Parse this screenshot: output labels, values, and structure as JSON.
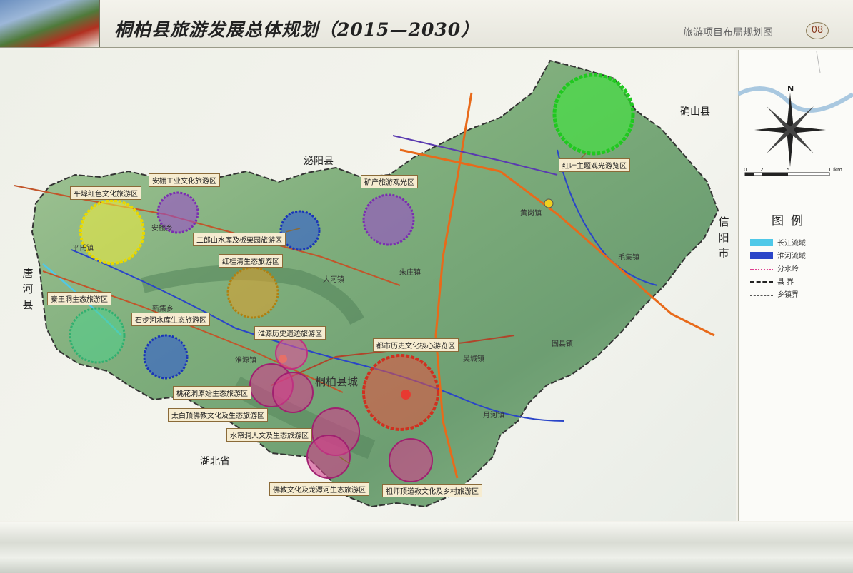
{
  "header": {
    "title": "桐柏县旅游发展总体规划（2015—2030）",
    "subtitle": "旅游项目布局规划图",
    "page_number": "08"
  },
  "surrounding_regions": {
    "biyang": "泌阳县",
    "queshan": "确山县",
    "xinyang": "信阳市",
    "tanghe": "唐河县",
    "hubei": "湖北省"
  },
  "towns": {
    "county_seat": "桐柏县城",
    "dahe": "大河镇",
    "zhuzhuang": "朱庄镇",
    "huanggang": "黄岗镇",
    "maoji": "毛集镇",
    "guxian": "固县镇",
    "wucheng": "吴城镇",
    "yuehe": "月河镇",
    "xinji": "新集乡",
    "huaiyuan": "淮源镇",
    "pingshi": "平氏镇",
    "anpeng": "安棚乡"
  },
  "zones": [
    {
      "label": "平埠红色文化旅游区",
      "color": "#f2ee3a"
    },
    {
      "label": "安棚工业文化旅游区",
      "color": "#9a4fc8"
    },
    {
      "label": "二郎山水库及板栗园旅游区",
      "color": "#2a55d8"
    },
    {
      "label": "矿产旅游观光区",
      "color": "#9a4fc8"
    },
    {
      "label": "红叶主题观光游览区",
      "color": "#3ee83a"
    },
    {
      "label": "红桂清生态旅游区",
      "color": "#d9a030"
    },
    {
      "label": "秦王洞生态旅游区",
      "color": "#4ed08a"
    },
    {
      "label": "石步河水库生态旅游区",
      "color": "#2a55d8"
    },
    {
      "label": "淮源历史遗迹旅游区",
      "color": "#e0509a"
    },
    {
      "label": "都市历史文化核心游览区",
      "color": "#e85040"
    },
    {
      "label": "桃花洞原始生态旅游区",
      "color": "#d0408a"
    },
    {
      "label": "太白顶佛教文化及生态旅游区",
      "color": "#d0408a"
    },
    {
      "label": "水帘洞人文及生态旅游区",
      "color": "#d0408a"
    },
    {
      "label": "佛教文化及龙潭河生态旅游区",
      "color": "#d0408a"
    },
    {
      "label": "祖师顶道教文化及乡村旅游区",
      "color": "#d0408a"
    }
  ],
  "compass": {
    "north_label": "N"
  },
  "scale_bar": {
    "ticks": [
      "0",
      "1",
      "2",
      "5",
      "10km"
    ]
  },
  "legend": {
    "title": "图例",
    "items": [
      {
        "label": "长江流域",
        "color": "#4fc8e8"
      },
      {
        "label": "淮河流域",
        "color": "#2a45c8"
      },
      {
        "label": "分水岭",
        "color": "#e04090"
      },
      {
        "label": "县  界",
        "color": "#222222"
      },
      {
        "label": "乡镇界",
        "color": "#555555"
      }
    ]
  }
}
